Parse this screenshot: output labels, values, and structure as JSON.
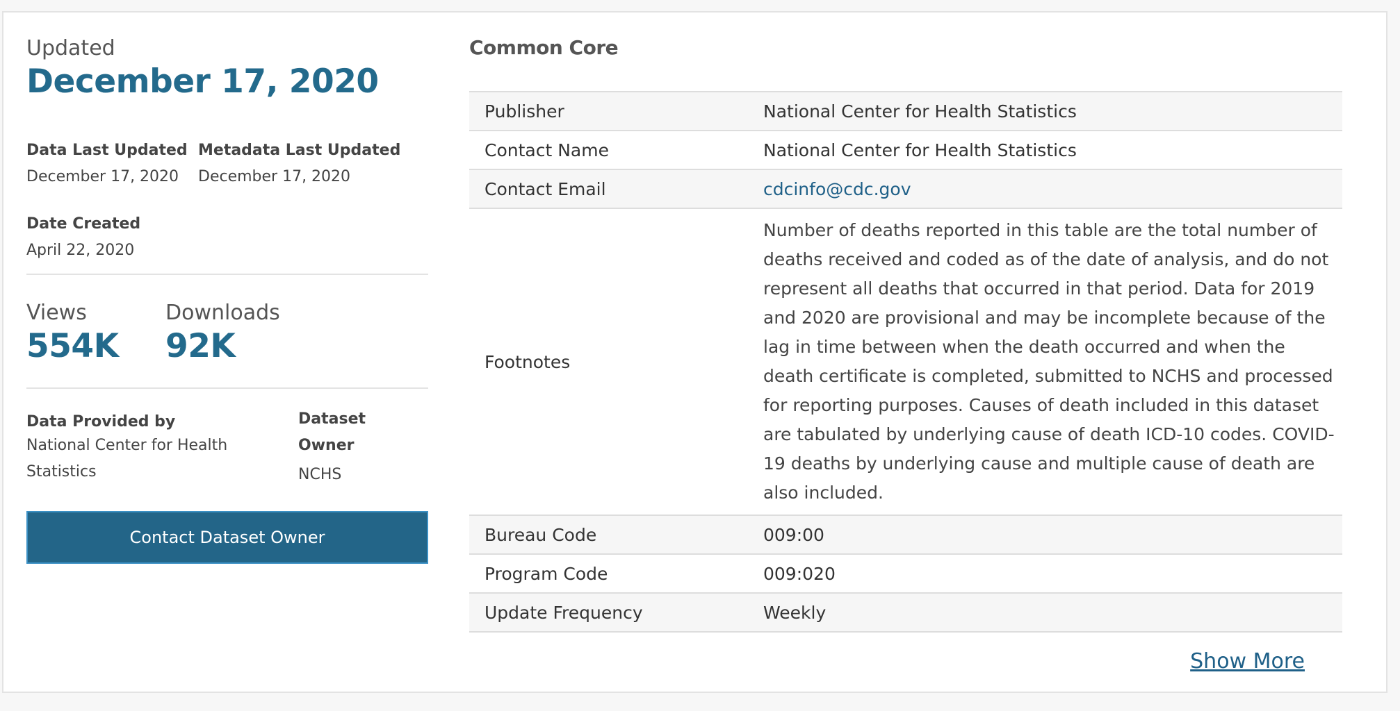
{
  "sidebar": {
    "updated_label": "Updated",
    "updated_date": "December 17, 2020",
    "data_last_updated": {
      "label": "Data Last Updated",
      "value": "December 17, 2020"
    },
    "metadata_last_updated": {
      "label": "Metadata Last Updated",
      "value": "December 17, 2020"
    },
    "date_created": {
      "label": "Date Created",
      "value": "April 22, 2020"
    },
    "views": {
      "label": "Views",
      "value": "554K"
    },
    "downloads": {
      "label": "Downloads",
      "value": "92K"
    },
    "data_provided_by": {
      "label": "Data Provided by",
      "value": "National Center for Health Statistics"
    },
    "dataset_owner": {
      "label": "Dataset Owner",
      "value": "NCHS"
    },
    "contact_button_label": "Contact Dataset Owner"
  },
  "common_core": {
    "title": "Common Core",
    "rows": [
      {
        "key": "Publisher",
        "value": "National Center for Health Statistics"
      },
      {
        "key": "Contact Name",
        "value": "National Center for Health Statistics"
      },
      {
        "key": "Contact Email",
        "value": "cdcinfo@cdc.gov"
      },
      {
        "key": "Footnotes",
        "value": "Number of deaths reported in this table are the total number of deaths received and coded as of the date of analysis, and do not represent all deaths that occurred in that period. Data for 2019 and 2020 are provisional and may be incomplete because of the lag in time between when the death occurred and when the death certificate is completed, submitted to NCHS and processed for reporting purposes. Causes of death included in this dataset are tabulated by underlying cause of death ICD-10 codes. COVID-19 deaths by underlying cause and multiple cause of death are also included."
      },
      {
        "key": "Bureau Code",
        "value": "009:00"
      },
      {
        "key": "Program Code",
        "value": "009:020"
      },
      {
        "key": "Update Frequency",
        "value": "Weekly"
      }
    ],
    "show_more_label": "Show More"
  },
  "colors": {
    "accent": "#236a8c",
    "button": "#236588",
    "link": "#1f6088",
    "row_shade": "#f6f6f6"
  }
}
